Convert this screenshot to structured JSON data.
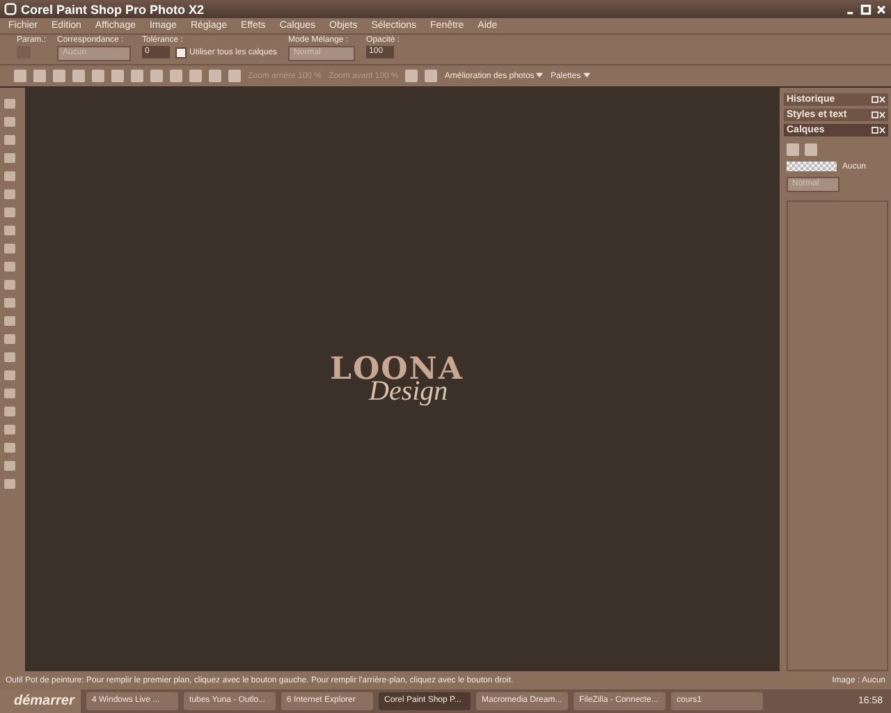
{
  "window": {
    "title": "Corel Paint Shop Pro Photo X2"
  },
  "menu": [
    "Fichier",
    "Edition",
    "Affichage",
    "Image",
    "Réglage",
    "Effets",
    "Calques",
    "Objets",
    "Sélections",
    "Fenêtre",
    "Aide"
  ],
  "options": {
    "param_label": "Param.:",
    "match_label": "Correspondance :",
    "match_value": "Aucun",
    "tolerance_label": "Tolérance :",
    "tolerance_value": "0",
    "all_layers": {
      "label": "Utiliser tous les calques",
      "checked": false
    },
    "blend_label": "Mode Mélange :",
    "blend_value": "Normal",
    "opacity_label": "Opacité :",
    "opacity_value": "100"
  },
  "toolbar": {
    "zoom_out": "Zoom arrière 100 %",
    "zoom_in": "Zoom avant 100 %",
    "menus": [
      "Amélioration des photos",
      "Palettes"
    ]
  },
  "canvas": {
    "logo_top": "LOONA",
    "logo_bottom": "Design"
  },
  "panels": [
    {
      "title": "Historique",
      "expanded": false
    },
    {
      "title": "Styles et text",
      "expanded": false
    },
    {
      "title": "Calques",
      "expanded": true
    }
  ],
  "layers": {
    "aucun_label": "Aucun",
    "blend_value": "Normal"
  },
  "status_bar": {
    "message": "Outil Pot de peinture: Pour remplir le premier plan, cliquez avec le bouton gauche. Pour remplir l'arrière-plan, cliquez avec le bouton droit.",
    "image": "Image : Aucun"
  },
  "taskbar": {
    "start": "démarrer",
    "items": [
      {
        "label": "4 Windows Live ...",
        "selected": false
      },
      {
        "label": "tubes Yuna - Outlo...",
        "selected": false
      },
      {
        "label": "6 Internet Explorer",
        "selected": false
      },
      {
        "label": "Corel Paint Shop P...",
        "selected": true
      },
      {
        "label": "Macromedia Dream...",
        "selected": false
      },
      {
        "label": "FileZilla - Connecte...",
        "selected": false
      },
      {
        "label": "cours1",
        "selected": false
      }
    ],
    "clock": "16:58"
  }
}
